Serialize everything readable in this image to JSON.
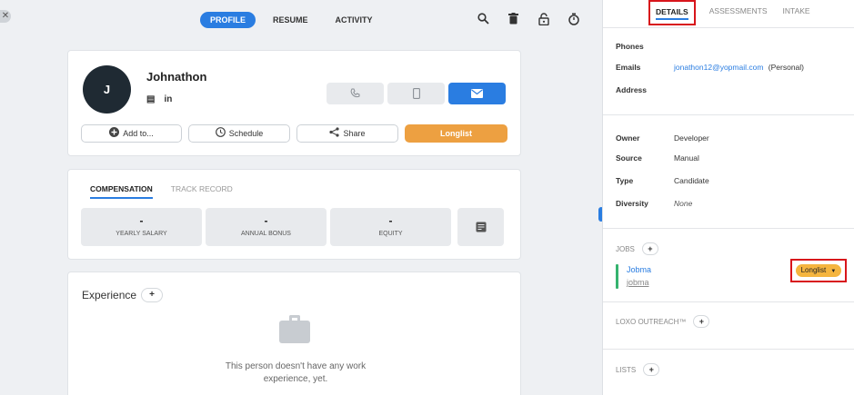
{
  "left": {
    "close_icon": "✕",
    "nav_tabs": [
      {
        "label": "PROFILE"
      },
      {
        "label": "RESUME"
      },
      {
        "label": "ACTIVITY"
      }
    ],
    "toolbar_icons": [
      "search-icon",
      "trash-icon",
      "lock-icon",
      "timer-icon"
    ],
    "profile": {
      "initial": "J",
      "name": "Johnathon",
      "social": {
        "doc": "▤",
        "linkedin": "in"
      }
    },
    "contact_buttons": [
      "phone-icon",
      "mobile-icon",
      "email-icon"
    ],
    "actions": {
      "add_to": "Add to...",
      "schedule": "Schedule",
      "share": "Share",
      "longlist": "Longlist"
    },
    "comp_tabs": [
      "COMPENSATION",
      "TRACK RECORD"
    ],
    "comp_boxes": [
      {
        "value": "-",
        "label": "YEARLY SALARY"
      },
      {
        "value": "-",
        "label": "ANNUAL BONUS"
      },
      {
        "value": "-",
        "label": "EQUITY"
      }
    ],
    "experience": {
      "title": "Experience",
      "empty_text": "This person doesn't have any work experience, yet."
    }
  },
  "right": {
    "tabs": [
      "DETAILS",
      "ASSESSMENTS",
      "INTAKE"
    ],
    "contact": {
      "phones_label": "Phones",
      "emails_label": "Emails",
      "email_value": "jonathon12@yopmail.com",
      "email_type": "(Personal)",
      "address_label": "Address"
    },
    "info": [
      {
        "key": "Owner",
        "value": "Developer"
      },
      {
        "key": "Source",
        "value": "Manual"
      },
      {
        "key": "Type",
        "value": "Candidate"
      },
      {
        "key": "Diversity",
        "value": "None"
      }
    ],
    "jobs": {
      "title": "JOBS",
      "name": "Jobma",
      "sub": "jobma",
      "status": "Longlist"
    },
    "outreach_title": "LOXO OUTREACH™",
    "lists_title": "LISTS",
    "plus": "+"
  }
}
